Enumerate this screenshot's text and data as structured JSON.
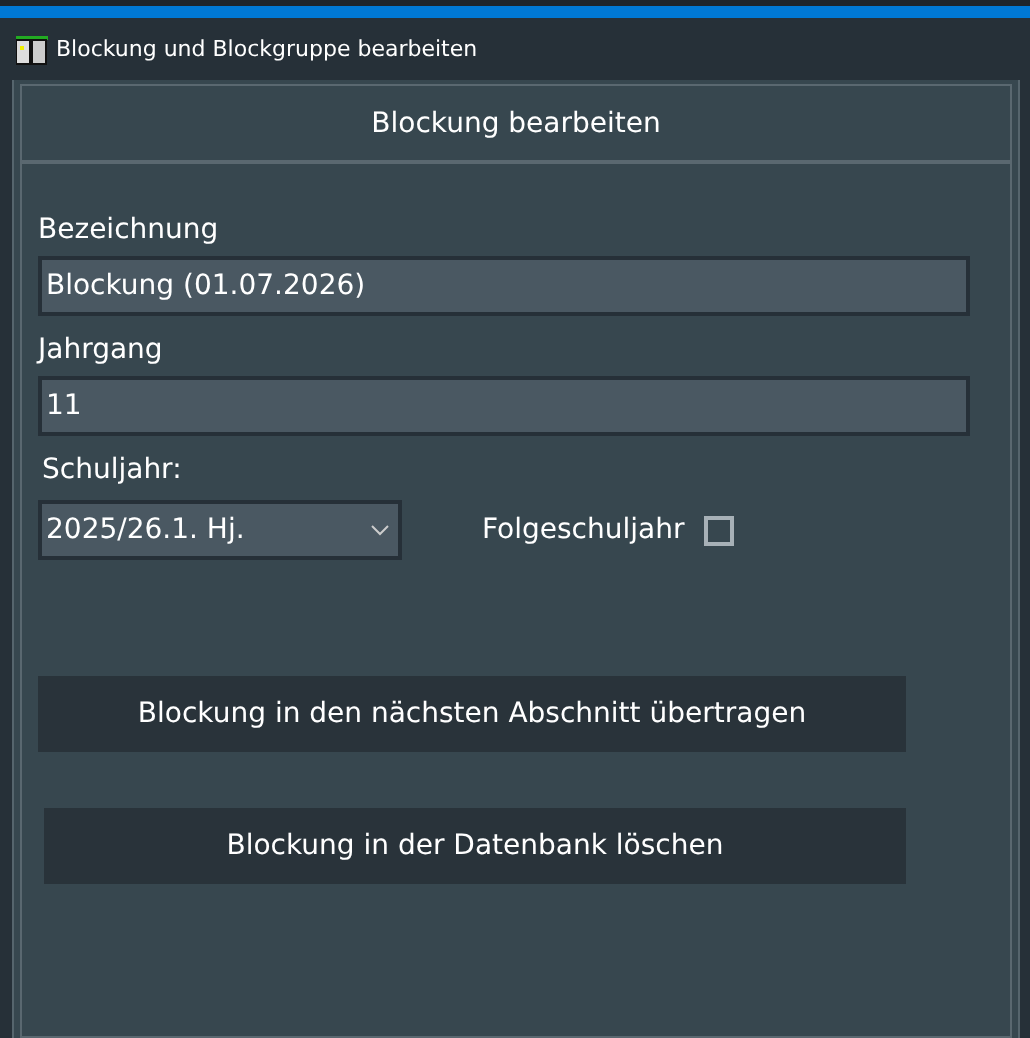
{
  "window": {
    "title": "Blockung und Blockgruppe bearbeiten"
  },
  "panel": {
    "title": "Blockung bearbeiten"
  },
  "fields": [
    {
      "label": "Bezeichnung",
      "value": "Blockung (01.07.2026)"
    },
    {
      "label": "Jahrgang",
      "value": "11"
    }
  ],
  "school_year": {
    "label": "Schuljahr:",
    "value": "2025/26.1. Hj."
  },
  "next_year": {
    "label": "Folgeschuljahr",
    "checked": false
  },
  "buttons": [
    "Blockung in den nächsten Abschnitt übertragen",
    "Blockung in der Datenbank löschen"
  ]
}
